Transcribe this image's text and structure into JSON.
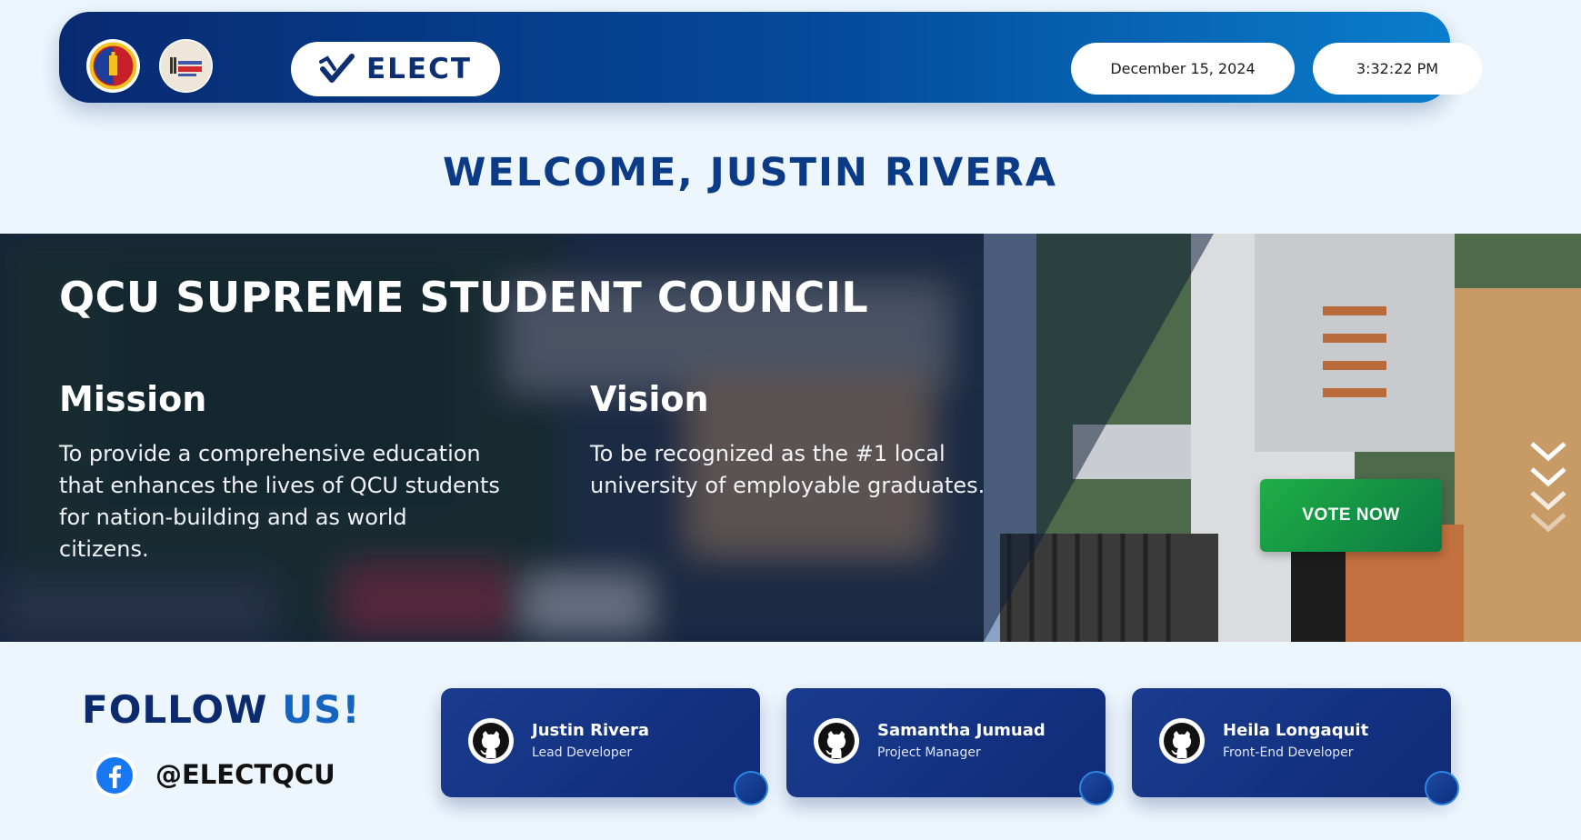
{
  "header": {
    "logo1_alt": "Quezon City University seal",
    "logo2_alt": "QCU SSC logo",
    "brand": "ELECT",
    "date": "December 15, 2024",
    "time": "3:32:22 PM"
  },
  "welcome": "WELCOME, JUSTIN RIVERA",
  "hero": {
    "title": "QCU SUPREME STUDENT COUNCIL",
    "mission_heading": "Mission",
    "mission_lines": [
      "To provide a comprehensive education",
      "that enhances the lives of QCU students",
      "for nation-building and as world",
      "citizens."
    ],
    "vision_heading": "Vision",
    "vision_lines": [
      "To be recognized as the #1 local",
      "university of employable graduates."
    ],
    "vote_label": "VOTE NOW"
  },
  "footer": {
    "follow_a": "FOLLOW ",
    "follow_b": "US!",
    "handle": "@ELECTQCU",
    "developers": [
      {
        "name": "Justin Rivera",
        "role": "Lead Developer"
      },
      {
        "name": "Samantha Jumuad",
        "role": "Project Manager"
      },
      {
        "name": "Heila Longaquit",
        "role": "Front-End Developer"
      }
    ]
  },
  "colors": {
    "accent": "#0b3a86",
    "vote": "#1fae45",
    "card": "#14327f"
  }
}
